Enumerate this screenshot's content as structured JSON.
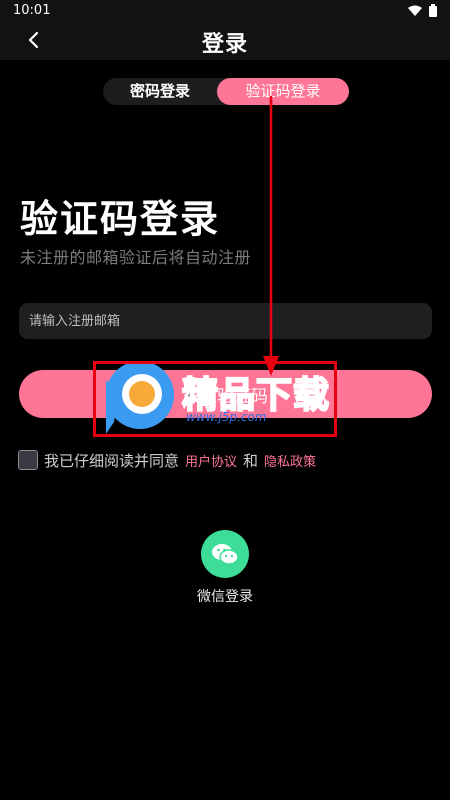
{
  "status_bar": {
    "time": "10:01"
  },
  "header": {
    "title": "登录"
  },
  "tabs": [
    {
      "label": "密码登录",
      "active": false
    },
    {
      "label": "验证码登录",
      "active": true
    }
  ],
  "main": {
    "title": "验证码登录",
    "subtitle": "未注册的邮箱验证后将自动注册",
    "email_placeholder": "请输入注册邮箱",
    "email_value": "",
    "get_code_label": "获取验证码"
  },
  "agreement": {
    "text": "我已仔细阅读并同意",
    "terms_link": "用户协议",
    "and": "和",
    "privacy_link": "隐私政策",
    "checked": false
  },
  "social": {
    "wechat_label": "微信登录"
  },
  "watermark": {
    "text": "精品下载",
    "url": "www.j5p.com"
  },
  "colors": {
    "accent": "#ff7596",
    "background": "#000000",
    "input_bg": "#1f1f1f",
    "wechat": "#3ddc97",
    "annotation": "#e60012"
  }
}
